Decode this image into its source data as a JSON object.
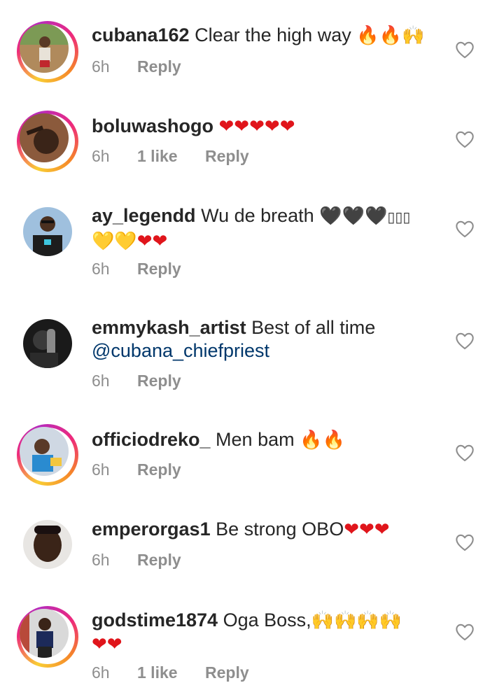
{
  "comments": [
    {
      "username": "cubana162",
      "text": "Clear the high way",
      "emoji": [
        "🔥",
        "🔥",
        "🙌"
      ],
      "time": "6h",
      "likes": "",
      "reply": "Reply"
    },
    {
      "username": "boluwashogo",
      "text": "",
      "emoji": [
        "❤",
        "❤",
        "❤",
        "❤",
        "❤"
      ],
      "time": "6h",
      "likes": "1 like",
      "reply": "Reply"
    },
    {
      "username": "ay_legendd",
      "text": "Wu de breath",
      "emoji": [
        "🖤",
        "🖤",
        "🖤",
        "▯▯▯",
        "💛",
        "💛",
        "❤",
        "❤"
      ],
      "time": "6h",
      "likes": "",
      "reply": "Reply"
    },
    {
      "username": "emmykash_artist",
      "text": "Best of all time",
      "mention": "@cubana_chiefpriest",
      "time": "6h",
      "likes": "",
      "reply": "Reply"
    },
    {
      "username": "officiodreko_",
      "text": "Men bam",
      "emoji": [
        "🔥",
        "🔥"
      ],
      "time": "6h",
      "likes": "",
      "reply": "Reply"
    },
    {
      "username": "emperorgas1",
      "text": "Be strong OBO",
      "emoji": [
        "❤",
        "❤",
        "❤"
      ],
      "time": "6h",
      "likes": "",
      "reply": "Reply"
    },
    {
      "username": "godstime1874",
      "text": "Oga Boss,",
      "emoji": [
        "🙌",
        "🙌",
        "🙌",
        "🙌",
        "❤",
        "❤"
      ],
      "time": "6h",
      "likes": "1 like",
      "reply": "Reply"
    }
  ],
  "colors": {
    "text": "#262626",
    "meta": "#8e8e8e",
    "mention": "#00376b",
    "heart_emoji": "#e0151b"
  },
  "icons": {
    "like": "heart-outline-icon"
  }
}
